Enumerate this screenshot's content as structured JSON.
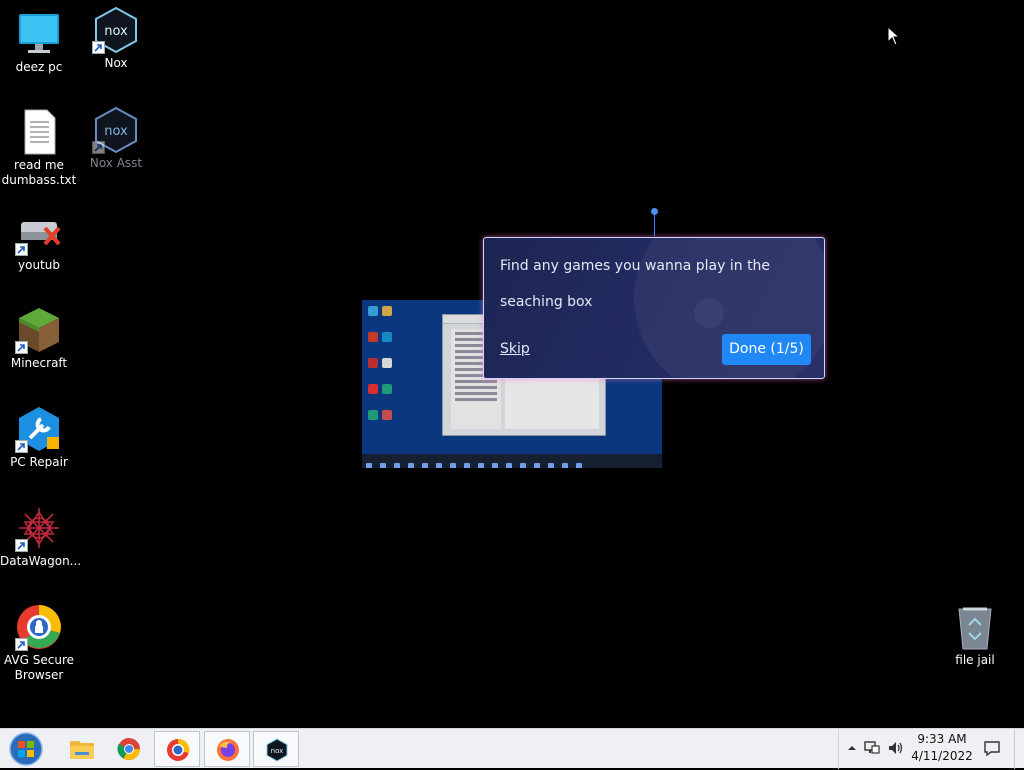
{
  "desktop": {
    "icons": [
      {
        "label": "deez pc",
        "icon": "monitor-icon"
      },
      {
        "label": "Nox",
        "icon": "nox-icon"
      },
      {
        "label": "read me dumbass.txt",
        "icon": "text-file-icon"
      },
      {
        "label": "Nox Asst",
        "icon": "nox-icon"
      },
      {
        "label": "youtub",
        "icon": "drive-error-icon"
      },
      {
        "label": "Minecraft",
        "icon": "minecraft-icon"
      },
      {
        "label": "PC Repair",
        "icon": "pc-repair-icon"
      },
      {
        "label": "DataWagon...",
        "icon": "datawagon-icon"
      },
      {
        "label": "AVG Secure Browser",
        "icon": "avg-browser-icon"
      },
      {
        "label": "file jail",
        "icon": "recycle-bin-icon"
      }
    ]
  },
  "tooltip": {
    "message": "Find any games you wanna play in the seaching box",
    "skip_label": "Skip",
    "done_label": "Done (1/5)"
  },
  "taskbar": {
    "apps": [
      {
        "name": "File Explorer",
        "icon": "folder-icon"
      },
      {
        "name": "Google Chrome",
        "icon": "chrome-icon"
      },
      {
        "name": "AVG Secure Browser",
        "icon": "avg-browser-icon"
      },
      {
        "name": "Firefox",
        "icon": "firefox-icon"
      },
      {
        "name": "Nox",
        "icon": "nox-icon"
      }
    ],
    "clock": {
      "time": "9:33 AM",
      "date": "4/11/2022"
    }
  },
  "colors": {
    "desktop_bg": "#000000",
    "tooltip_bg": "#1d2554",
    "done_button": "#1f88f5",
    "taskbar_bg": "#eef0f3"
  }
}
